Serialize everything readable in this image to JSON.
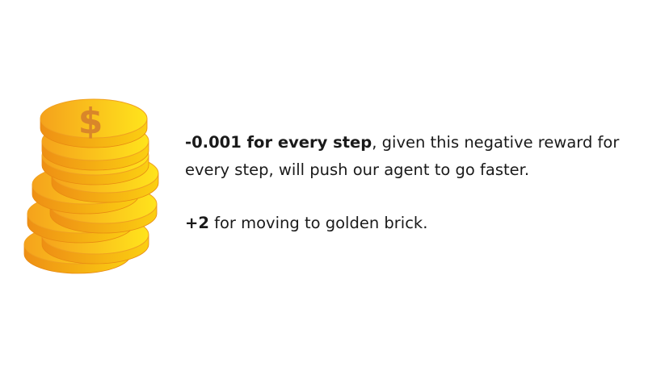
{
  "image": {
    "icon": "gold-coin-stack-icon",
    "coin_symbol": "$",
    "colors": {
      "gold_light": "#ffe11a",
      "gold_dark": "#f59e1b",
      "dollar": "#d9862a"
    }
  },
  "rewards": [
    {
      "value_bold": "-0.001 for every step",
      "description": ", given this negative reward for every step, will push our agent to go faster."
    },
    {
      "value_bold": "+2",
      "description": " for moving to golden brick."
    }
  ]
}
